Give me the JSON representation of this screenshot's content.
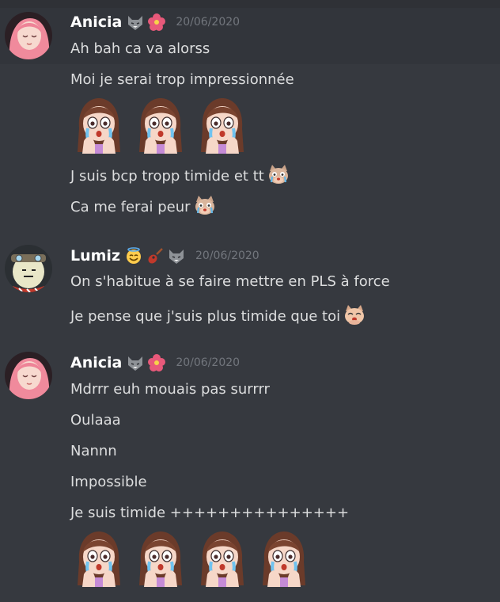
{
  "messages": [
    {
      "author": "Anicia",
      "timestamp": "20/06/2020",
      "badges": [
        "wolf-emote-icon",
        "hibiscus-icon"
      ],
      "lines": [
        "Ah bah ca va alorss",
        "Moi je serai trop impressionnée"
      ],
      "emote_row": [
        "crying-girl-emote",
        "crying-girl-emote",
        "crying-girl-emote"
      ],
      "lines_after": [
        "J suis bcp tropp timide et tt",
        "Ca me ferai peur"
      ]
    },
    {
      "author": "Lumiz",
      "timestamp": "20/06/2020",
      "badges": [
        "halo-smile-icon",
        "guitar-icon",
        "wolf-emote-icon"
      ],
      "lines": [
        "On s'habitue à se faire mettre en PLS à force",
        "Je pense que j'suis plus timide que toi"
      ]
    },
    {
      "author": "Anicia",
      "timestamp": "20/06/2020",
      "badges": [
        "wolf-emote-icon",
        "hibiscus-icon"
      ],
      "lines": [
        "Mdrrr euh mouais pas surrrr",
        "Oulaaa",
        "Nannn",
        "Impossible",
        "Je suis timide +++++++++++++++"
      ],
      "emote_row": [
        "crying-girl-emote",
        "crying-girl-emote",
        "crying-girl-emote",
        "crying-girl-emote"
      ]
    }
  ],
  "colors": {
    "background": "#36393f",
    "username": "#ffffff",
    "text": "#dcddde",
    "timestamp": "#72767d"
  }
}
